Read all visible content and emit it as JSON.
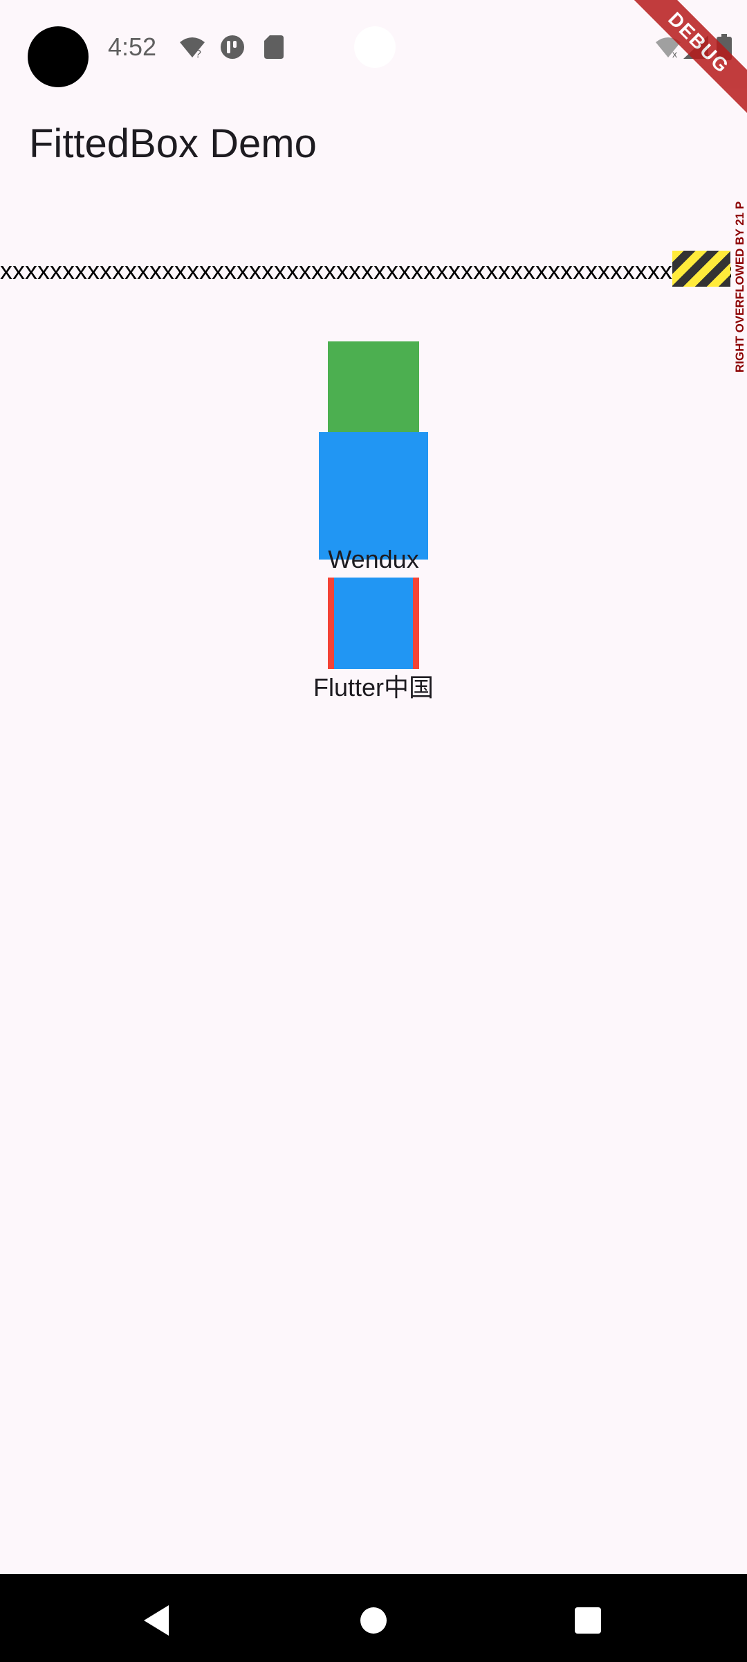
{
  "status_bar": {
    "time": "4:52",
    "icons": [
      "wifi-question-icon",
      "accessibility-icon",
      "sd-card-icon",
      "wifi-off-icon",
      "signal-icon",
      "battery-icon"
    ]
  },
  "debug_banner": "DEBUG",
  "app_bar": {
    "title": "FittedBox Demo"
  },
  "overflow_row": {
    "text": "xxxxxxxxxxxxxxxxxxxxxxxxxxxxxxxxxxxxxxxxxxxxxxxxxxxxxxxxxxxxxxxx",
    "warning": "RIGHT OVERFLOWED BY 21 P"
  },
  "demo": {
    "label1": "Wendux",
    "label2": "Flutter中国"
  },
  "colors": {
    "green": "#4caf50",
    "blue": "#2196f3",
    "red": "#f44336",
    "background": "#fdf7fb"
  },
  "nav_bar": {
    "icons": [
      "back-icon",
      "home-icon",
      "recents-icon"
    ]
  }
}
